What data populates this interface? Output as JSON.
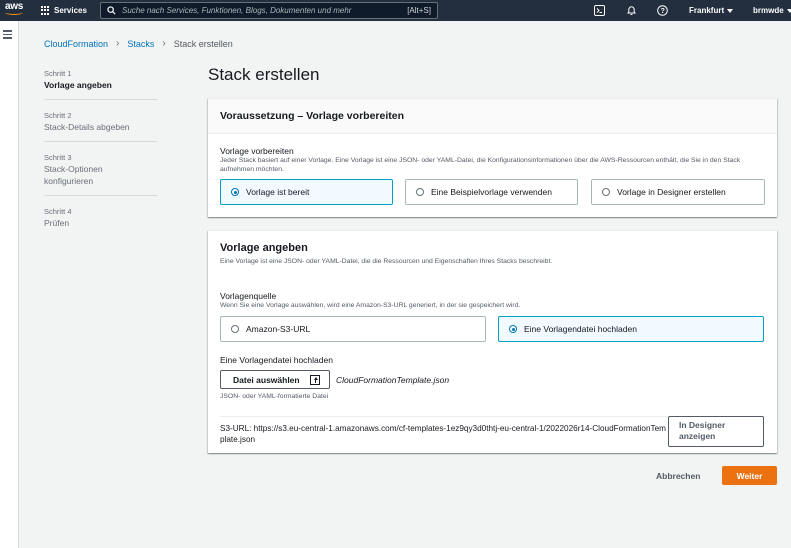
{
  "topnav": {
    "logo": "aws",
    "services_label": "Services",
    "search_placeholder": "Suche nach Services, Funktionen, Blogs, Dokumenten und mehr",
    "search_shortcut": "[Alt+S]",
    "region": "Frankfurt",
    "user": "brmwde",
    "icons": [
      "cloudshell-icon",
      "bell-icon",
      "help-icon"
    ]
  },
  "breadcrumb": {
    "items": [
      "CloudFormation",
      "Stacks",
      "Stack erstellen"
    ]
  },
  "steps": [
    {
      "num": "Schritt 1",
      "name": "Vorlage angeben",
      "active": true
    },
    {
      "num": "Schritt 2",
      "name": "Stack-Details abgeben",
      "active": false
    },
    {
      "num": "Schritt 3",
      "name": "Stack-Optionen konfigurieren",
      "active": false
    },
    {
      "num": "Schritt 4",
      "name": "Prüfen",
      "active": false
    }
  ],
  "page_title": "Stack erstellen",
  "prereq": {
    "title": "Voraussetzung – Vorlage vorbereiten",
    "label": "Vorlage vorbereiten",
    "description": "Jeder Stack basiert auf einer Vorlage. Eine Vorlage ist eine JSON- oder YAML-Datei, die Konfigurationsinformationen über die AWS-Ressourcen enthält, die Sie in den Stack aufnehmen möchten.",
    "options": [
      "Vorlage ist bereit",
      "Eine Beispielvorlage verwenden",
      "Vorlage in Designer erstellen"
    ],
    "selected": "Vorlage ist bereit"
  },
  "specify": {
    "title": "Vorlage angeben",
    "description": "Eine Vorlage ist eine JSON- oder YAML-Datei, die die Ressourcen und Eigenschaften Ihres Stacks beschreibt.",
    "source_label": "Vorlagenquelle",
    "source_desc": "Wenn Sie eine Vorlage auswählen, wird eine Amazon-S3-URL generiert, in der sie gespeichert wird.",
    "source_options": [
      "Amazon-S3-URL",
      "Eine Vorlagendatei hochladen"
    ],
    "source_selected": "Eine Vorlagendatei hochladen",
    "upload_label": "Eine Vorlagendatei hochladen",
    "choose_file": "Datei auswählen",
    "file_name": "CloudFormationTemplate.json",
    "file_hint": "JSON- oder YAML-formatierte Datei",
    "s3_url": "S3-URL:  https://s3.eu-central-1.amazonaws.com/cf-templates-1ez9qy3d0thtj-eu-central-1/2022026r14-CloudFormationTemplate.json",
    "designer_button": "In Designer anzeigen"
  },
  "actions": {
    "cancel": "Abbrechen",
    "next": "Weiter"
  },
  "colors": {
    "nav_bg": "#232f3e",
    "link": "#0073bb",
    "primary": "#ec7211",
    "selected_border": "#00a1c9"
  }
}
